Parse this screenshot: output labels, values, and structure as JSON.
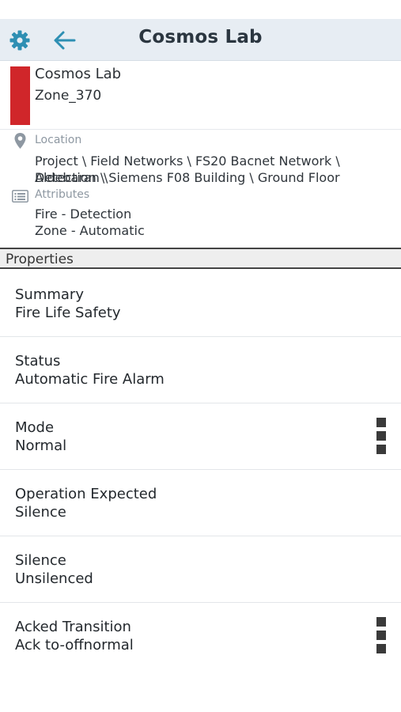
{
  "header": {
    "title": "Cosmos Lab",
    "settings_icon": "gear-icon",
    "back_icon": "arrow-left-icon"
  },
  "object": {
    "name": "Cosmos Lab",
    "zone": "Zone_370",
    "status_color": "#d0262a"
  },
  "location": {
    "label": "Location",
    "line1": "Project \\ Field Networks \\ FS20 Bacnet Network \\ Aldebaran \\",
    "line2": "Detection \\ Siemens F08 Building \\ Ground Floor"
  },
  "attributes": {
    "label": "Attributes",
    "line1": "Fire - Detection",
    "line2": "Zone - Automatic"
  },
  "properties": {
    "section_title": "Properties",
    "rows": [
      {
        "label": "Summary",
        "value": "Fire Life Safety"
      },
      {
        "label": "Status",
        "value": "Automatic Fire Alarm"
      },
      {
        "label": "Mode",
        "value": "Normal"
      },
      {
        "label": "Operation Expected",
        "value": "Silence"
      },
      {
        "label": "Silence",
        "value": "Unsilenced"
      },
      {
        "label": "Acked Transition",
        "value": "Ack to-offnormal"
      }
    ]
  },
  "colors": {
    "header_bg": "#e7edf3",
    "accent": "#2e8fb3",
    "alarm_red": "#d0262a"
  }
}
